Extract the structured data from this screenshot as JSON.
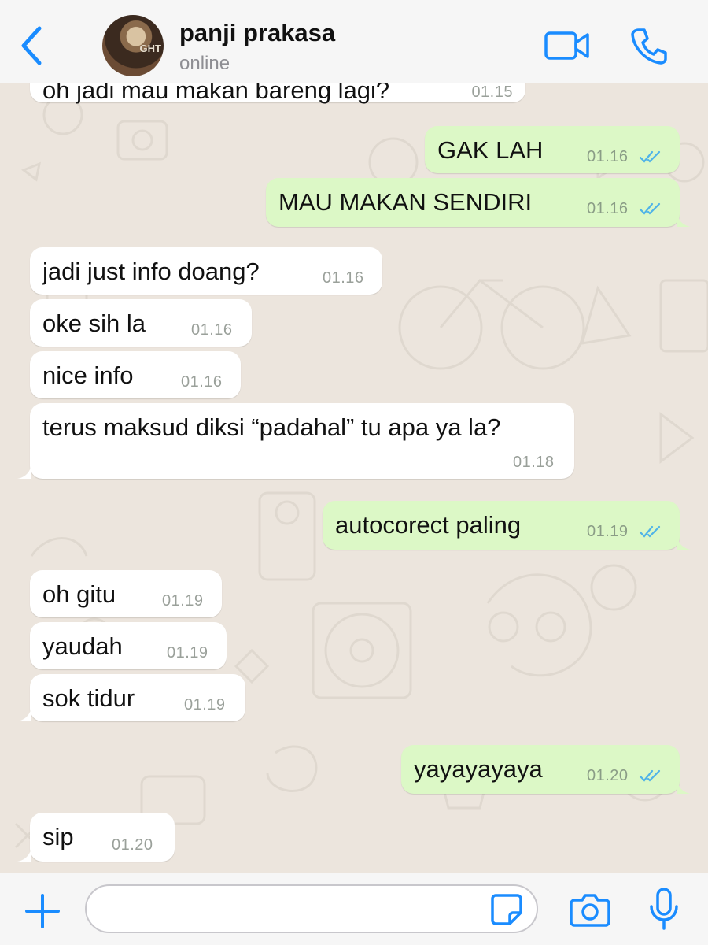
{
  "header": {
    "back_icon": "chevron-left-icon",
    "avatar_overlay_text": "GHT",
    "contact_name": "panji prakasa",
    "status": "online",
    "video_icon": "video-camera-icon",
    "call_icon": "phone-icon"
  },
  "accent_color": "#1a8cff",
  "colors": {
    "chat_background": "#ece5dd",
    "incoming_bubble": "#ffffff",
    "outgoing_bubble": "#dcf8c6",
    "read_ticks": "#4fb3e8"
  },
  "messages": [
    {
      "dir": "in",
      "text": "oh jadi mau makan bareng lagi?",
      "time": "01.15",
      "partial": true
    },
    {
      "dir": "out",
      "text": "GAK LAH",
      "time": "01.16",
      "status": "read"
    },
    {
      "dir": "out",
      "text": "MAU MAKAN SENDIRI",
      "time": "01.16",
      "status": "read"
    },
    {
      "dir": "in",
      "text": "jadi just info doang?",
      "time": "01.16"
    },
    {
      "dir": "in",
      "text": "oke sih la",
      "time": "01.16"
    },
    {
      "dir": "in",
      "text": "nice info",
      "time": "01.16"
    },
    {
      "dir": "in",
      "text": "terus maksud diksi “padahal” tu apa ya la?",
      "time": "01.18"
    },
    {
      "dir": "out",
      "text": "autocorect paling",
      "time": "01.19",
      "status": "read"
    },
    {
      "dir": "in",
      "text": "oh gitu",
      "time": "01.19"
    },
    {
      "dir": "in",
      "text": "yaudah",
      "time": "01.19"
    },
    {
      "dir": "in",
      "text": "sok tidur",
      "time": "01.19"
    },
    {
      "dir": "out",
      "text": "yayayayaya",
      "time": "01.20",
      "status": "read"
    },
    {
      "dir": "in",
      "text": "sip",
      "time": "01.20"
    }
  ],
  "input_bar": {
    "plus_icon": "plus-icon",
    "message_value": "",
    "sticker_icon": "sticker-icon",
    "camera_icon": "camera-icon",
    "mic_icon": "microphone-icon"
  }
}
